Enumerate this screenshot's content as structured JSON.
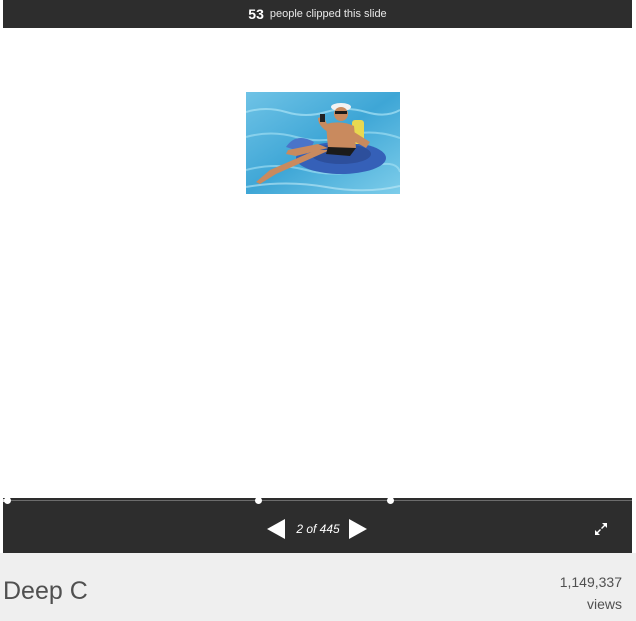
{
  "clip_bar": {
    "count": "53",
    "text": "people clipped this slide"
  },
  "slide": {
    "image": "man-on-pool-float-photo",
    "progress_fraction": 0.0045
  },
  "controls": {
    "prev_icon": "triangle-left-icon",
    "next_icon": "triangle-right-icon",
    "page_indicator": "2 of 445",
    "expand_icon": "fullscreen-icon"
  },
  "footer": {
    "title": "Deep C",
    "views_count": "1,149,337",
    "views_label": "views"
  },
  "colors": {
    "bar_background": "#2d2d2d",
    "footer_background": "#efefef",
    "text_gray": "#505050"
  }
}
